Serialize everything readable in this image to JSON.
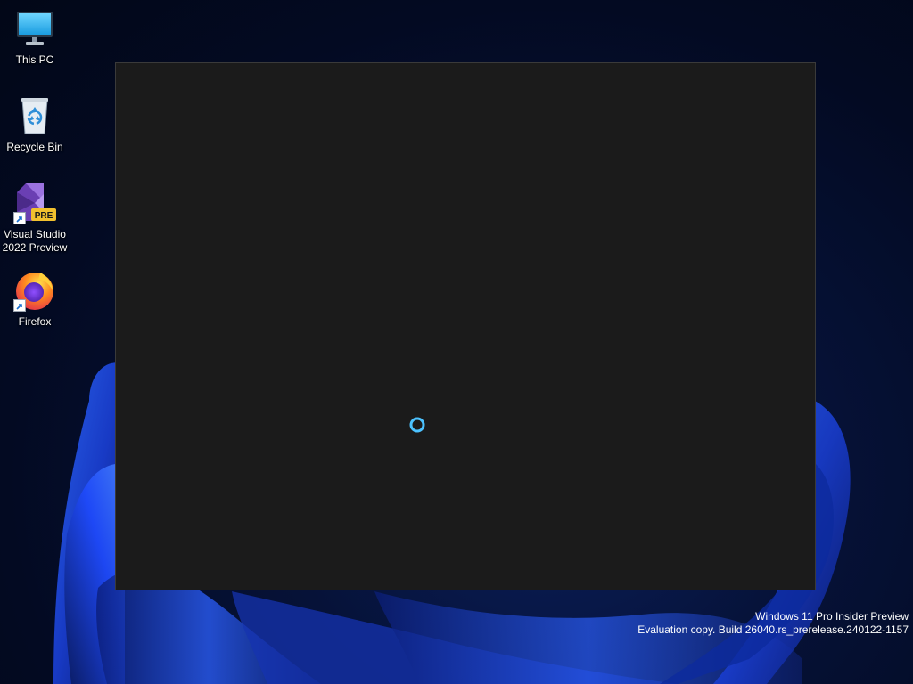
{
  "desktop": {
    "icons": [
      {
        "name": "this-pc",
        "label": "This PC",
        "icon": "monitor-icon"
      },
      {
        "name": "recycle-bin",
        "label": "Recycle Bin",
        "icon": "recycle-bin-icon"
      },
      {
        "name": "visual-studio-2022-preview",
        "label": "Visual Studio 2022 Preview",
        "icon": "visual-studio-icon",
        "badge": "PRE",
        "shortcut": true
      },
      {
        "name": "firefox",
        "label": "Firefox",
        "icon": "firefox-icon",
        "shortcut": true
      }
    ]
  },
  "window": {
    "state": "loading",
    "background": "#1b1b1b",
    "spinner_color": "#4cc2ff"
  },
  "watermark": {
    "line1": "Windows 11 Pro Insider Preview",
    "line2": "Evaluation copy. Build 26040.rs_prerelease.240122-1157"
  },
  "colors": {
    "wallpaper_accent": "#1f4bff",
    "vs_purple": "#865fc5",
    "pre_badge": "#f2c12e"
  }
}
